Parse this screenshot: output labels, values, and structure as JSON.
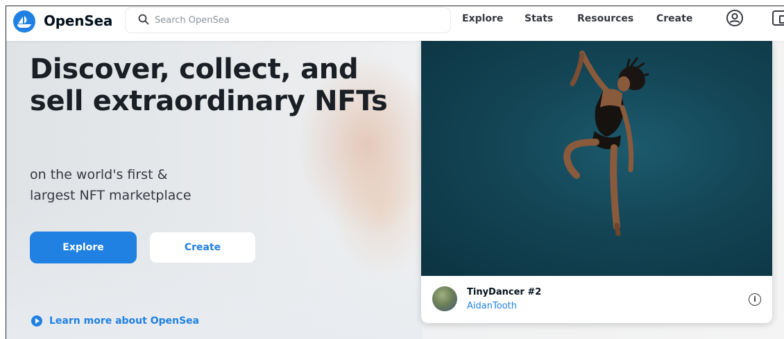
{
  "header": {
    "brand": "OpenSea",
    "search_placeholder": "Search OpenSea",
    "nav": [
      "Explore",
      "Stats",
      "Resources",
      "Create"
    ]
  },
  "hero": {
    "headline": "Discover, collect, and sell extraordinary NFTs",
    "subline_1": "on the world's first &",
    "subline_2": "largest NFT marketplace",
    "explore_label": "Explore",
    "create_label": "Create",
    "learn_more": "Learn more about OpenSea"
  },
  "featured": {
    "name": "TinyDancer #2",
    "creator": "AidanTooth",
    "info_glyph": "i"
  },
  "colors": {
    "accent": "#2081e2",
    "text_dark": "#04111d"
  },
  "icons": [
    "opensea-logo-icon",
    "search-icon",
    "account-icon",
    "wallet-icon",
    "play-icon",
    "info-icon"
  ]
}
